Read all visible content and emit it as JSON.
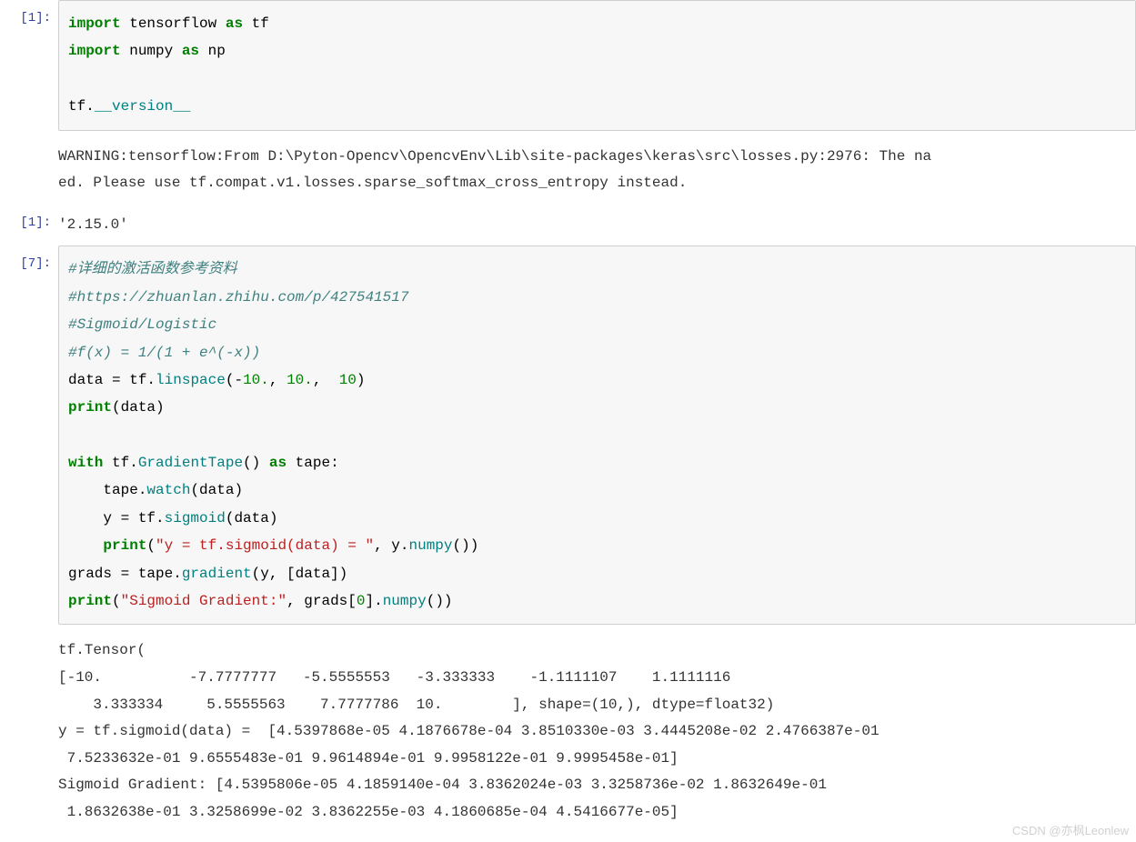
{
  "cell1": {
    "prompt": "[1]:",
    "code_tokens": [
      {
        "t": "import ",
        "c": "kw-green"
      },
      {
        "t": "tensorflow ",
        "c": ""
      },
      {
        "t": "as ",
        "c": "kw-green"
      },
      {
        "t": "tf",
        "c": ""
      },
      {
        "t": "\n",
        "c": ""
      },
      {
        "t": "import ",
        "c": "kw-green"
      },
      {
        "t": "numpy ",
        "c": ""
      },
      {
        "t": "as ",
        "c": "kw-green"
      },
      {
        "t": "np",
        "c": ""
      },
      {
        "t": "\n",
        "c": ""
      },
      {
        "t": "\n",
        "c": ""
      },
      {
        "t": "tf",
        "c": ""
      },
      {
        "t": ".",
        "c": ""
      },
      {
        "t": "__version__",
        "c": "nm-teal"
      }
    ],
    "stderr": "WARNING:tensorflow:From D:\\Pyton-Opencv\\OpencvEnv\\Lib\\site-packages\\keras\\src\\losses.py:2976: The na\ned. Please use tf.compat.v1.losses.sparse_softmax_cross_entropy instead.\n",
    "out_prompt": "[1]:",
    "out_value": "'2.15.0'"
  },
  "cell2": {
    "prompt": "[7]:",
    "code_tokens": [
      {
        "t": "#详细的激活函数参考资料",
        "c": "comment"
      },
      {
        "t": "\n",
        "c": ""
      },
      {
        "t": "#https://zhuanlan.zhihu.com/p/427541517",
        "c": "comment"
      },
      {
        "t": "\n",
        "c": ""
      },
      {
        "t": "#Sigmoid/Logistic",
        "c": "comment"
      },
      {
        "t": "\n",
        "c": ""
      },
      {
        "t": "#f(x) = 1/(1 + e^(-x))",
        "c": "comment"
      },
      {
        "t": "\n",
        "c": ""
      },
      {
        "t": "data ",
        "c": ""
      },
      {
        "t": "= ",
        "c": ""
      },
      {
        "t": "tf",
        "c": ""
      },
      {
        "t": ".",
        "c": ""
      },
      {
        "t": "linspace",
        "c": "nm-teal"
      },
      {
        "t": "(",
        "c": ""
      },
      {
        "t": "-",
        "c": ""
      },
      {
        "t": "10.",
        "c": "num-green"
      },
      {
        "t": ", ",
        "c": ""
      },
      {
        "t": "10.",
        "c": "num-green"
      },
      {
        "t": ",  ",
        "c": ""
      },
      {
        "t": "10",
        "c": "num-green"
      },
      {
        "t": ")",
        "c": ""
      },
      {
        "t": "\n",
        "c": ""
      },
      {
        "t": "print",
        "c": "kw-green"
      },
      {
        "t": "(data)",
        "c": ""
      },
      {
        "t": "\n",
        "c": ""
      },
      {
        "t": "\n",
        "c": ""
      },
      {
        "t": "with ",
        "c": "kw-green"
      },
      {
        "t": "tf",
        "c": ""
      },
      {
        "t": ".",
        "c": ""
      },
      {
        "t": "GradientTape",
        "c": "nm-teal"
      },
      {
        "t": "() ",
        "c": ""
      },
      {
        "t": "as ",
        "c": "kw-green"
      },
      {
        "t": "tape:",
        "c": ""
      },
      {
        "t": "\n",
        "c": ""
      },
      {
        "t": "    tape",
        "c": ""
      },
      {
        "t": ".",
        "c": ""
      },
      {
        "t": "watch",
        "c": "nm-teal"
      },
      {
        "t": "(data)",
        "c": ""
      },
      {
        "t": "\n",
        "c": ""
      },
      {
        "t": "    y ",
        "c": ""
      },
      {
        "t": "= ",
        "c": ""
      },
      {
        "t": "tf",
        "c": ""
      },
      {
        "t": ".",
        "c": ""
      },
      {
        "t": "sigmoid",
        "c": "nm-teal"
      },
      {
        "t": "(data)",
        "c": ""
      },
      {
        "t": "\n",
        "c": ""
      },
      {
        "t": "    ",
        "c": ""
      },
      {
        "t": "print",
        "c": "kw-green"
      },
      {
        "t": "(",
        "c": ""
      },
      {
        "t": "\"y = tf.sigmoid(data) = \"",
        "c": "str-red"
      },
      {
        "t": ", y",
        "c": ""
      },
      {
        "t": ".",
        "c": ""
      },
      {
        "t": "numpy",
        "c": "nm-teal"
      },
      {
        "t": "())",
        "c": ""
      },
      {
        "t": "\n",
        "c": ""
      },
      {
        "t": "grads ",
        "c": ""
      },
      {
        "t": "= ",
        "c": ""
      },
      {
        "t": "tape",
        "c": ""
      },
      {
        "t": ".",
        "c": ""
      },
      {
        "t": "gradient",
        "c": "nm-teal"
      },
      {
        "t": "(y, [data])",
        "c": ""
      },
      {
        "t": "\n",
        "c": ""
      },
      {
        "t": "print",
        "c": "kw-green"
      },
      {
        "t": "(",
        "c": ""
      },
      {
        "t": "\"Sigmoid Gradient:\"",
        "c": "str-red"
      },
      {
        "t": ", grads[",
        "c": ""
      },
      {
        "t": "0",
        "c": "num-green"
      },
      {
        "t": "]",
        "c": ""
      },
      {
        "t": ".",
        "c": ""
      },
      {
        "t": "numpy",
        "c": "nm-teal"
      },
      {
        "t": "())",
        "c": ""
      }
    ],
    "stdout": "tf.Tensor(\n[-10.          -7.7777777   -5.5555553   -3.333333    -1.1111107    1.1111116\n    3.333334     5.5555563    7.7777786  10.        ], shape=(10,), dtype=float32)\ny = tf.sigmoid(data) =  [4.5397868e-05 4.1876678e-04 3.8510330e-03 3.4445208e-02 2.4766387e-01\n 7.5233632e-01 9.6555483e-01 9.9614894e-01 9.9958122e-01 9.9995458e-01]\nSigmoid Gradient: [4.5395806e-05 4.1859140e-04 3.8362024e-03 3.3258736e-02 1.8632649e-01\n 1.8632638e-01 3.3258699e-02 3.8362255e-03 4.1860685e-04 4.5416677e-05]"
  },
  "watermark": "CSDN @亦枫Leonlew"
}
